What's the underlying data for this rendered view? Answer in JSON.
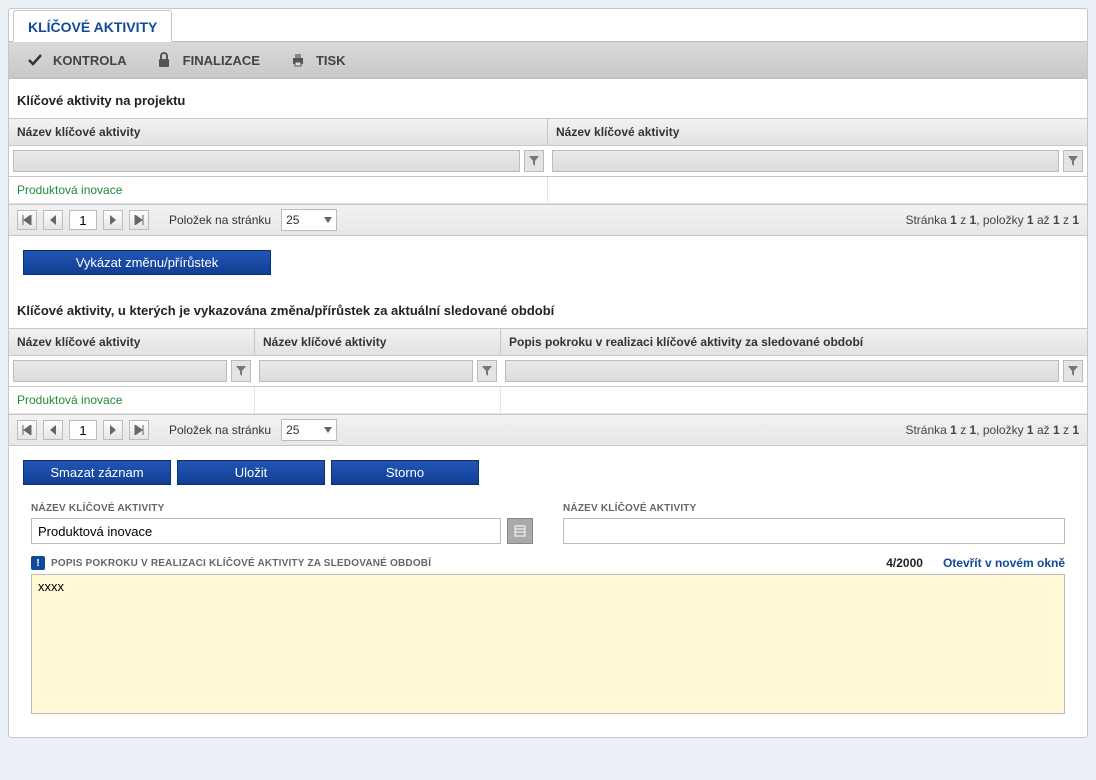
{
  "tab": {
    "label": "KLÍČOVÉ AKTIVITY"
  },
  "toolbar": {
    "kontrola": "KONTROLA",
    "finalizace": "FINALIZACE",
    "tisk": "TISK"
  },
  "sections": {
    "top_title": "Klíčové aktivity na projektu",
    "bottom_title": "Klíčové aktivity, u kterých je vykazována změna/přírůstek za aktuální sledované období"
  },
  "grid1": {
    "headers": [
      "Název klíčové aktivity",
      "Název klíčové aktivity"
    ],
    "row": [
      "Produktová inovace",
      ""
    ]
  },
  "grid2": {
    "headers": [
      "Název klíčové aktivity",
      "Název klíčové aktivity",
      "Popis pokroku v realizaci klíčové aktivity za sledované období"
    ],
    "row": [
      "Produktová inovace",
      "",
      ""
    ]
  },
  "pager": {
    "page": "1",
    "items_label": "Položek na stránku",
    "page_size": "25",
    "summary_prefix": "Stránka ",
    "summary_p": "1",
    "summary_of": " z ",
    "summary_pt": "1",
    "summary_items_prefix": ", položky ",
    "summary_i1": "1",
    "summary_to": " až ",
    "summary_i2": "1",
    "summary_of2": " z ",
    "summary_total": "1"
  },
  "buttons": {
    "vykazat": "Vykázat změnu/přírůstek",
    "smazat": "Smazat záznam",
    "ulozit": "Uložit",
    "storno": "Storno"
  },
  "form": {
    "name_label": "NÁZEV KLÍČOVÉ AKTIVITY",
    "name_value": "Produktová inovace",
    "name_label2": "NÁZEV KLÍČOVÉ AKTIVITY",
    "desc_label": "POPIS POKROKU V REALIZACI KLÍČOVÉ AKTIVITY ZA SLEDOVANÉ OBDOBÍ",
    "desc_value": "xxxx",
    "counter": "4/2000",
    "open_new": "Otevřít v novém okně"
  }
}
